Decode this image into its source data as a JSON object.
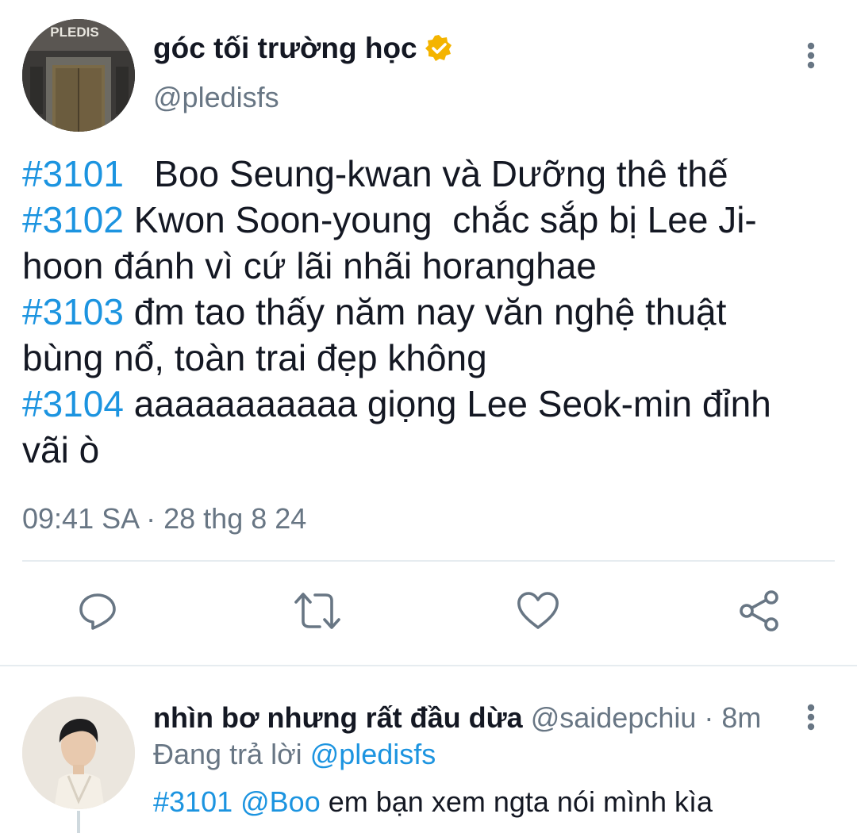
{
  "tweet": {
    "author": {
      "display_name": "góc tối trường học",
      "handle": "@pledisfs",
      "verified": true,
      "avatar_sign_text": "PLEDIS"
    },
    "lines": [
      {
        "tag": "#3101",
        "text": "   Boo Seung-kwan và Dưỡng thê thế"
      },
      {
        "tag": "#3102",
        "text": " Kwon Soon-young  chắc sắp bị Lee Ji-"
      },
      {
        "tag": "",
        "text": "hoon đánh vì cứ lãi nhãi horanghae"
      },
      {
        "tag": "#3103",
        "text": " đm tao thấy năm nay văn nghệ thuật"
      },
      {
        "tag": "",
        "text": "bùng nổ, toàn trai đẹp không"
      },
      {
        "tag": "#3104",
        "text": " aaaaaaaaaaa giọng Lee Seok-min đỉnh"
      },
      {
        "tag": "",
        "text": "vãi ò"
      }
    ],
    "timestamp": "09:41 SA · 28 thg 8 24"
  },
  "actions": {
    "reply_icon": "reply-icon",
    "retweet_icon": "retweet-icon",
    "like_icon": "heart-icon",
    "share_icon": "share-icon"
  },
  "reply": {
    "display_name": "nhìn bơ nhưng rất đầu dừa",
    "handle_time": " @saidepchiu · 8m",
    "replying_prefix": "Đang trả lời ",
    "replying_to": "@pledisfs",
    "hashtag": "#3101",
    "mention": "@Boo",
    "text": " em bạn xem ngta nói mình kìa"
  },
  "colors": {
    "accent": "#1c94e0",
    "secondary_text": "#687684",
    "primary_text": "#141823",
    "verified_badge": "#f4b400"
  }
}
